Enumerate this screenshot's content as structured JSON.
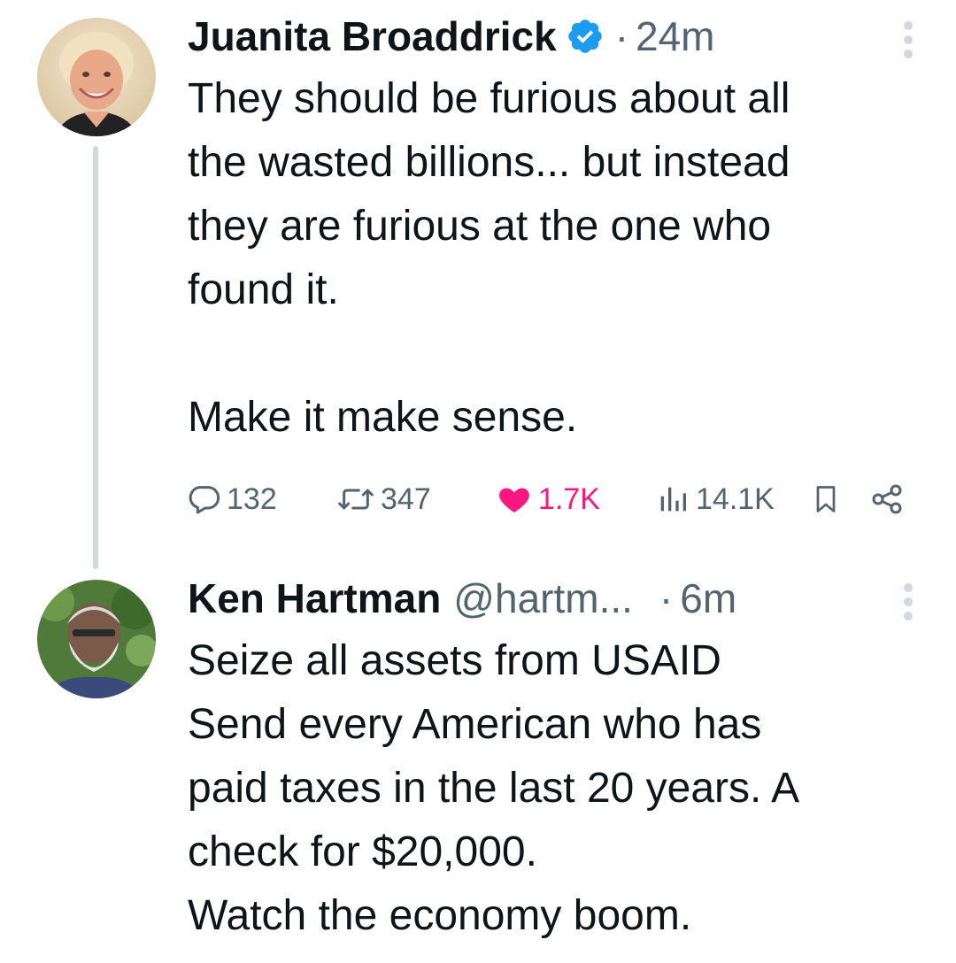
{
  "thread": [
    {
      "author_name": "Juanita Broaddrick",
      "verified": true,
      "separator": "·",
      "time": "24m",
      "text": "They should be furious about all\nthe wasted billions... but instead\nthey are furious at the one who\nfound it.\n\nMake it make sense.",
      "stats": {
        "replies": "132",
        "reposts": "347",
        "likes": "1.7K",
        "views": "14.1K"
      },
      "liked": true,
      "avatar_icon": "avatar-woman-smiling"
    },
    {
      "author_name": "Ken Hartman",
      "handle": "@hartm...",
      "separator": "·",
      "time": "6m",
      "text": "Seize all assets from USAID\nSend every American who has\npaid taxes in the last 20 years. A\ncheck for $20,000.\nWatch the economy boom.",
      "avatar_icon": "avatar-bearded-man"
    }
  ],
  "colors": {
    "text": "#0f1419",
    "secondary": "#536471",
    "verified": "#1d9bf0",
    "like": "#f91880",
    "thread_line": "#cfd9de"
  },
  "icons": {
    "reply": "reply-icon",
    "repost": "repost-icon",
    "like": "heart-icon",
    "views": "views-icon",
    "bookmark": "bookmark-icon",
    "share": "share-icon",
    "more": "more-vertical-icon",
    "verified": "verified-badge-icon"
  }
}
